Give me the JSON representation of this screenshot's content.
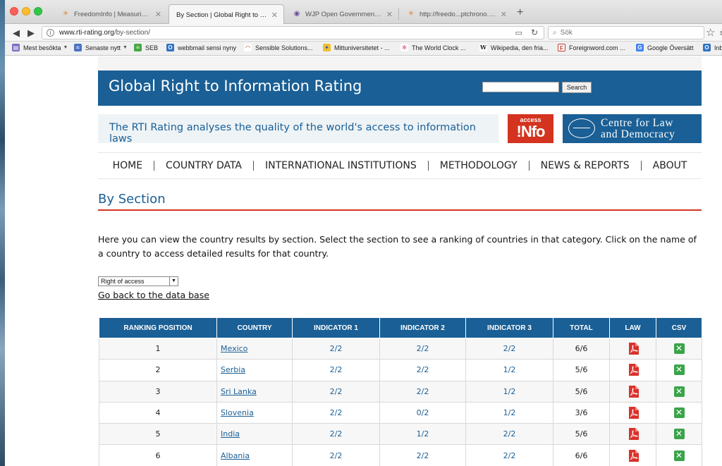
{
  "browser": {
    "tabs": [
      {
        "label": "FreedomInfo | Measuring O...",
        "active": false
      },
      {
        "label": "By Section | Global Right to Info...",
        "active": true
      },
      {
        "label": "WJP Open Government Ind...",
        "active": false
      },
      {
        "label": "http://freedo...ptchrono.docx",
        "active": false
      }
    ],
    "url_host": "www.rti-rating.org",
    "url_path": "/by-section/",
    "search_placeholder": "Sök",
    "bookmarks": [
      "Mest besökta",
      "Senaste nytt",
      "SEB",
      "webbmail sensi nyny",
      "Sensible Solutions...",
      "Mittuniversitetet - ...",
      "The World Clock ...",
      "Wikipedia, den fria...",
      "Foreignword.com ...",
      "Google Översätt",
      "Inb"
    ]
  },
  "site": {
    "title": "Global Right to Information Rating",
    "search_button": "Search",
    "tagline": "The RTI Rating analyses the quality of the world's access to information laws",
    "logo_access_line1": "access",
    "logo_access_line2": "!Nfo",
    "logo_clad_line1": "Centre for Law",
    "logo_clad_line2": "and Democracy",
    "nav": [
      "HOME",
      "COUNTRY DATA",
      "INTERNATIONAL INSTITUTIONS",
      "METHODOLOGY",
      "NEWS & REPORTS",
      "ABOUT"
    ]
  },
  "main": {
    "title": "By Section",
    "intro": "Here you can view the country results by section. Select the section to see a ranking of countries in that category. Click on the name of a country to access detailed results for that country.",
    "section_selected": "Right of access",
    "back_link": "Go back to the data base",
    "table": {
      "headers": [
        "RANKING POSITION",
        "COUNTRY",
        "INDICATOR 1",
        "INDICATOR 2",
        "INDICATOR 3",
        "TOTAL",
        "LAW",
        "CSV"
      ],
      "rows": [
        {
          "rank": "1",
          "country": "Mexico",
          "i1": "2/2",
          "i2": "2/2",
          "i3": "2/2",
          "total": "6/6"
        },
        {
          "rank": "2",
          "country": "Serbia",
          "i1": "2/2",
          "i2": "2/2",
          "i3": "1/2",
          "total": "5/6"
        },
        {
          "rank": "3",
          "country": "Sri Lanka",
          "i1": "2/2",
          "i2": "2/2",
          "i3": "1/2",
          "total": "5/6"
        },
        {
          "rank": "4",
          "country": "Slovenia",
          "i1": "2/2",
          "i2": "0/2",
          "i3": "1/2",
          "total": "3/6"
        },
        {
          "rank": "5",
          "country": "India",
          "i1": "2/2",
          "i2": "1/2",
          "i3": "2/2",
          "total": "5/6"
        },
        {
          "rank": "6",
          "country": "Albania",
          "i1": "2/2",
          "i2": "2/2",
          "i3": "2/2",
          "total": "6/6"
        }
      ]
    }
  },
  "icons": {
    "pdf": "pdf-icon",
    "csv": "excel-icon"
  },
  "colors": {
    "brand_blue": "#1a5f95",
    "accent_red": "#d4331f",
    "csv_green": "#3aa44a"
  }
}
